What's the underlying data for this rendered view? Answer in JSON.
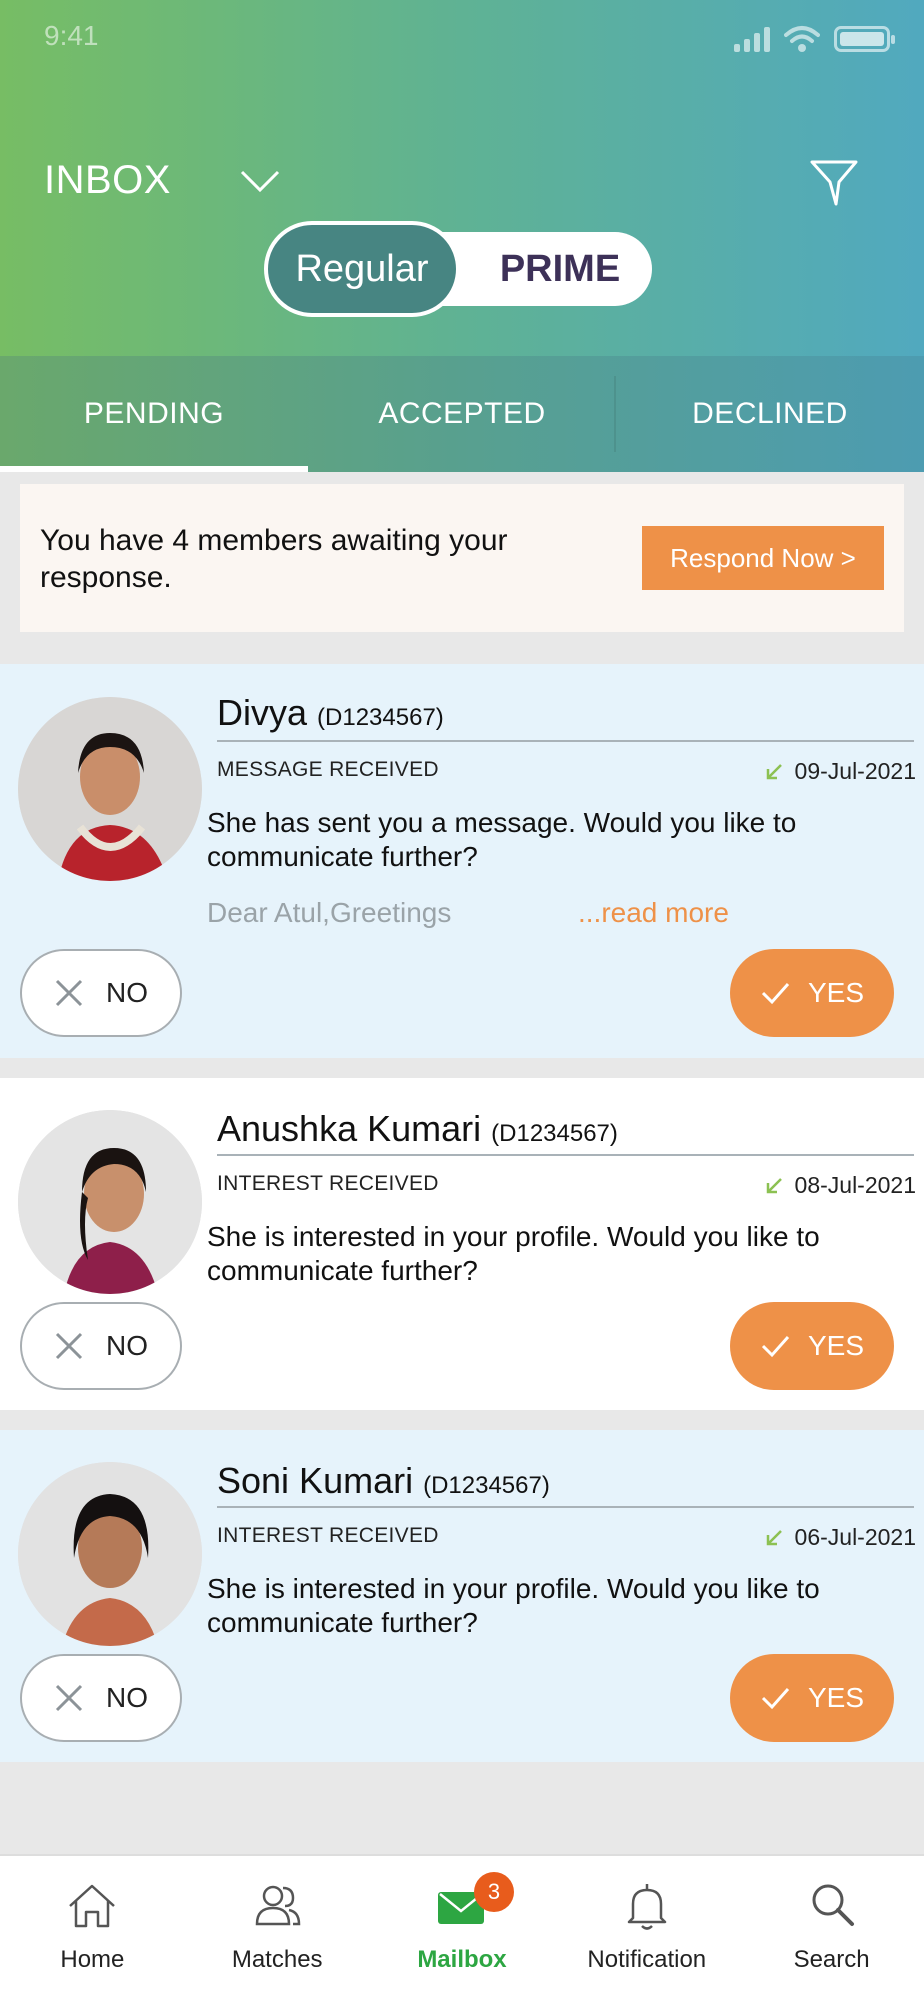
{
  "status_bar": {
    "time": "9:41"
  },
  "header": {
    "title": "INBOX",
    "toggle": {
      "regular": "Regular",
      "prime": "PRIME",
      "selected": "Regular"
    }
  },
  "tabs": [
    {
      "label": "PENDING",
      "active": true
    },
    {
      "label": "ACCEPTED",
      "active": false
    },
    {
      "label": "DECLINED",
      "active": false
    }
  ],
  "banner": {
    "text": "You have 4 members awaiting your response.",
    "button": "Respond Now >"
  },
  "cards": [
    {
      "name": "Divya",
      "profile_id": "(D1234567)",
      "type": "MESSAGE RECEIVED",
      "date": "09-Jul-2021",
      "message": "She has sent you a message. Would you like to communicate further?",
      "preview": "Dear Atul,Greetings",
      "read_more": "...read more",
      "no_label": "NO",
      "yes_label": "YES"
    },
    {
      "name": "Anushka Kumari",
      "profile_id": "(D1234567)",
      "type": "INTEREST RECEIVED",
      "date": "08-Jul-2021",
      "message": "She is interested in your profile. Would you like to communicate further?",
      "no_label": "NO",
      "yes_label": "YES"
    },
    {
      "name": "Soni Kumari",
      "profile_id": "(D1234567)",
      "type": "INTEREST RECEIVED",
      "date": "06-Jul-2021",
      "message": "She is interested in your profile. Would you like to communicate further?",
      "no_label": "NO",
      "yes_label": "YES"
    }
  ],
  "bottom_nav": [
    {
      "label": "Home",
      "icon": "home-icon",
      "active": false
    },
    {
      "label": "Matches",
      "icon": "users-icon",
      "active": false
    },
    {
      "label": "Mailbox",
      "icon": "mail-icon",
      "active": true,
      "badge": "3"
    },
    {
      "label": "Notification",
      "icon": "bell-icon",
      "active": false
    },
    {
      "label": "Search",
      "icon": "search-icon",
      "active": false
    }
  ],
  "colors": {
    "accent_orange": "#ee9148",
    "active_green": "#2da642",
    "card_blue": "#e6f3fb",
    "toggle_teal": "#478582"
  }
}
